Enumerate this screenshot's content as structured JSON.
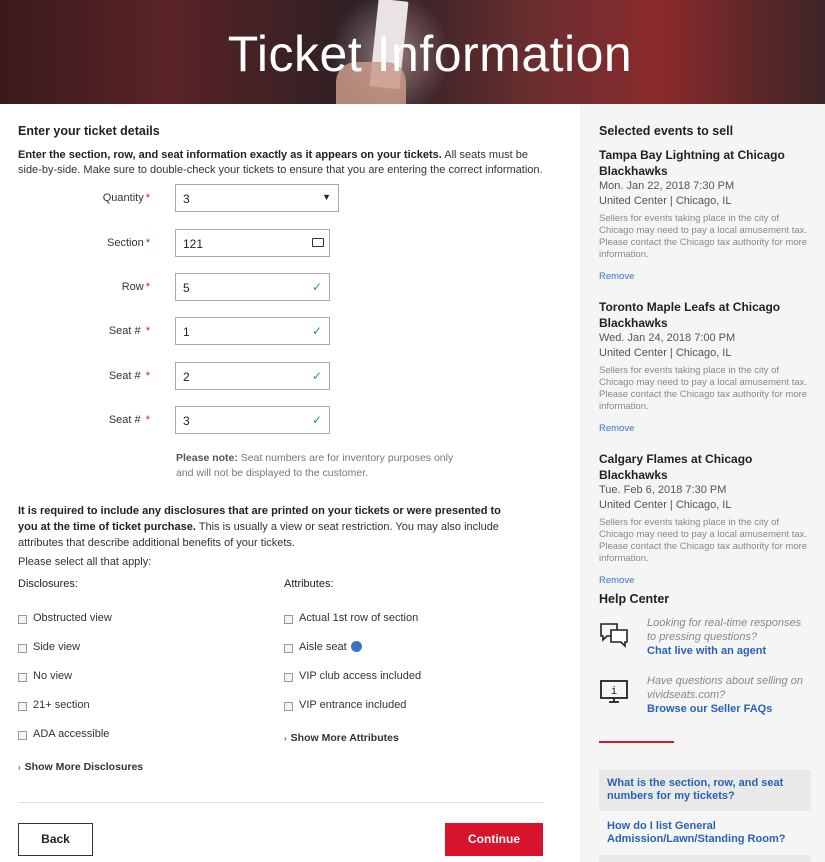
{
  "page": {
    "title": "Ticket Information"
  },
  "ticket_details": {
    "heading": "Enter your ticket details",
    "lead_bold": "Enter the section, row, and seat information exactly as it appears on your tickets.",
    "lead_rest": " All seats must be side-by-side. Make sure to double-check your tickets to ensure that you are entering the correct information.",
    "required_mark": "*",
    "fields": [
      {
        "label": "Quantity",
        "value": "3"
      },
      {
        "label": "Section",
        "value": "121"
      },
      {
        "label": "Row",
        "value": "5"
      },
      {
        "label": "Seat #",
        "value": "1"
      },
      {
        "label": "Seat #",
        "value": "2"
      },
      {
        "label": "Seat #",
        "value": "3"
      }
    ],
    "note_bold": "Please note:",
    "note_rest": " Seat numbers are for inventory purposes only and will not be displayed to the customer."
  },
  "disclosures": {
    "lead_bold": "It is required to include any disclosures that are printed on your tickets or were presented to you at the time of ticket purchase.",
    "lead_rest": " This is usually a view or seat restriction. You may also include attributes that describe additional benefits of your tickets.",
    "select_all": "Please select all that apply:",
    "disclosures_heading": "Disclosures:",
    "attributes_heading": "Attributes:",
    "disclosure_items": [
      "Obstructed view",
      "Side view",
      "No view",
      "21+ section",
      "ADA accessible"
    ],
    "attribute_items": [
      "Actual 1st row of section",
      "Aisle seat",
      "VIP club access included",
      "VIP entrance included"
    ],
    "show_more_attributes": "Show More Attributes",
    "show_more_disclosures": "Show More Disclosures"
  },
  "actions": {
    "back": "Back",
    "continue": "Continue"
  },
  "sidebar": {
    "title": "Selected events to sell",
    "tax_note": "Sellers for events taking place in the city of Chicago may need to pay a local amusement tax. Please contact the Chicago tax authority for more information.",
    "remove_label": "Remove",
    "events": [
      {
        "name": "Tampa Bay Lightning at Chicago Blackhawks",
        "date": "Mon. Jan 22, 2018 7:30 PM",
        "venue": "United Center | Chicago, IL"
      },
      {
        "name": "Toronto Maple Leafs at Chicago Blackhawks",
        "date": "Wed. Jan 24, 2018 7:00 PM",
        "venue": "United Center | Chicago, IL"
      },
      {
        "name": "Calgary Flames at Chicago Blackhawks",
        "date": "Tue. Feb 6, 2018 7:30 PM",
        "venue": "United Center | Chicago, IL"
      }
    ],
    "help": {
      "title": "Help Center",
      "chat_question": "Looking for real-time responses to pressing questions?",
      "chat_link": "Chat live with an agent",
      "faq_question": "Have questions about selling on vividseats.com?",
      "faq_link": "Browse our Seller FAQs"
    },
    "faqs": [
      "What is the section, row, and seat numbers for my tickets?",
      "How do I list General Admission/Lawn/Standing Room?"
    ]
  },
  "colors": {
    "brand_red": "#d7142b",
    "link_blue": "#2a62b5",
    "check_green": "#2e9d4b"
  }
}
